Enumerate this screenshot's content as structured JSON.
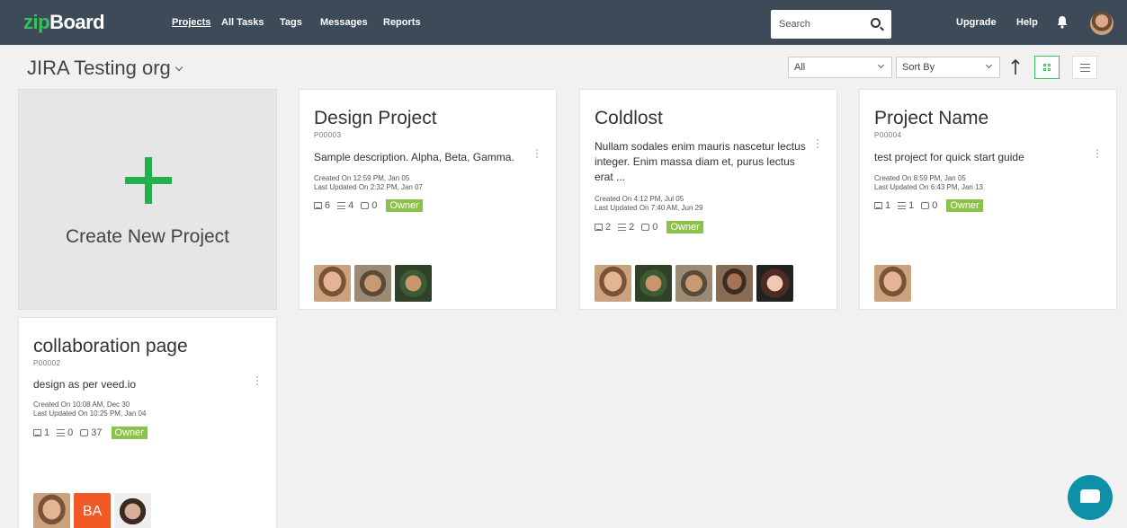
{
  "app": {
    "logo_zip": "zip",
    "logo_board": "Board",
    "brand_color": "#35c35a"
  },
  "nav": {
    "projects": "Projects",
    "all_tasks": "All Tasks",
    "tags": "Tags",
    "messages": "Messages",
    "reports": "Reports",
    "upgrade": "Upgrade",
    "help": "Help"
  },
  "search": {
    "placeholder": "Search"
  },
  "toolbar": {
    "org_title": "JIRA Testing org",
    "filter_value": "All",
    "sort_value": "Sort By"
  },
  "create_card": {
    "label": "Create New Project"
  },
  "projects": [
    {
      "title": "Design Project",
      "id": "P00003",
      "description": "Sample description. Alpha, Beta, Gamma.",
      "created": "Created On 12:59 PM, Jan 05",
      "updated": "Last Updated On 2:32 PM, Jan 07",
      "images": "6",
      "tasks": "4",
      "comments": "0",
      "role": "Owner"
    },
    {
      "title": "Coldlost",
      "id": "",
      "description": "Nullam sodales enim mauris nascetur lectus integer. Enim massa diam et, purus lectus erat ...",
      "created": "Created On 4:12 PM, Jul 05",
      "updated": "Last Updated On 7:40 AM, Jun 29",
      "images": "2",
      "tasks": "2",
      "comments": "0",
      "role": "Owner"
    },
    {
      "title": "Project Name",
      "id": "P00004",
      "description": "test project for quick start guide",
      "created": "Created On 8:59 PM, Jan 05",
      "updated": "Last Updated On 6:43 PM, Jan 13",
      "images": "1",
      "tasks": "1",
      "comments": "0",
      "role": "Owner"
    },
    {
      "title": "collaboration page",
      "id": "P00002",
      "description": "design as per veed.io",
      "created": "Created On 10:08 AM, Dec 30",
      "updated": "Last Updated On 10:25 PM, Jan 04",
      "images": "1",
      "tasks": "0",
      "comments": "37",
      "role": "Owner",
      "initials_avatar": "BA"
    }
  ]
}
